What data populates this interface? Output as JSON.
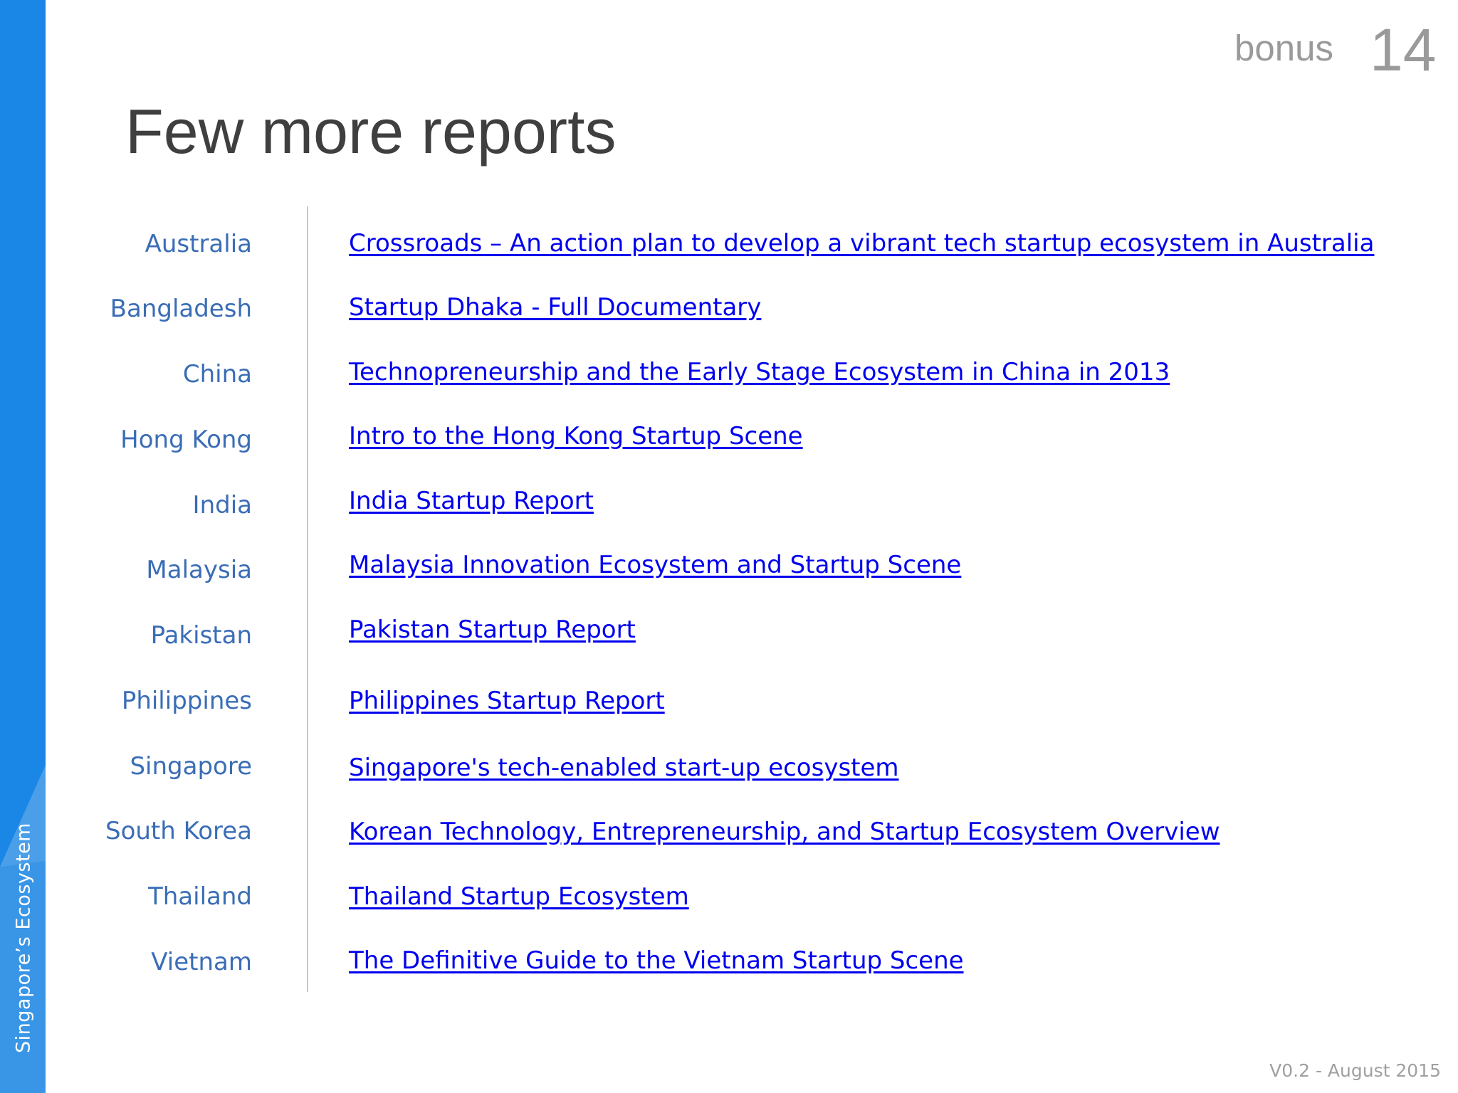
{
  "sidebar": {
    "label": "Singapore’s Ecosystem",
    "color": "#1a86e6"
  },
  "header": {
    "bonus": "bonus",
    "page_number": "14",
    "title": "Few more reports"
  },
  "reports": [
    {
      "country": "Australia",
      "link": "Crossroads – An action plan to develop a vibrant tech startup ecosystem in Australia"
    },
    {
      "country": "Bangladesh",
      "link": "Startup Dhaka - Full Documentary"
    },
    {
      "country": "China",
      "link": "Technopreneurship and the Early Stage Ecosystem in China in 2013"
    },
    {
      "country": "Hong Kong",
      "link": "Intro to the Hong Kong Startup Scene"
    },
    {
      "country": "India",
      "link": "India Startup Report"
    },
    {
      "country": "Malaysia",
      "link": "Malaysia Innovation Ecosystem and Startup Scene"
    },
    {
      "country": "Pakistan",
      "link": "Pakistan Startup Report"
    },
    {
      "country": "Philippines",
      "link": "Philippines Startup Report"
    },
    {
      "country": "Singapore",
      "link": "Singapore's tech-enabled start-up ecosystem"
    },
    {
      "country": "South Korea",
      "link": "Korean Technology, Entrepreneurship, and Startup Ecosystem Overview"
    },
    {
      "country": "Thailand",
      "link": "Thailand Startup Ecosystem"
    },
    {
      "country": "Vietnam",
      "link": "The Definitive Guide to the Vietnam Startup Scene"
    }
  ],
  "footer": {
    "version": "V0.2 - August 2015"
  },
  "colors": {
    "country_text": "#3a6db6",
    "link_text": "#0000ee",
    "title_text": "#3f3f3f",
    "muted_text": "#9a9a9a"
  }
}
